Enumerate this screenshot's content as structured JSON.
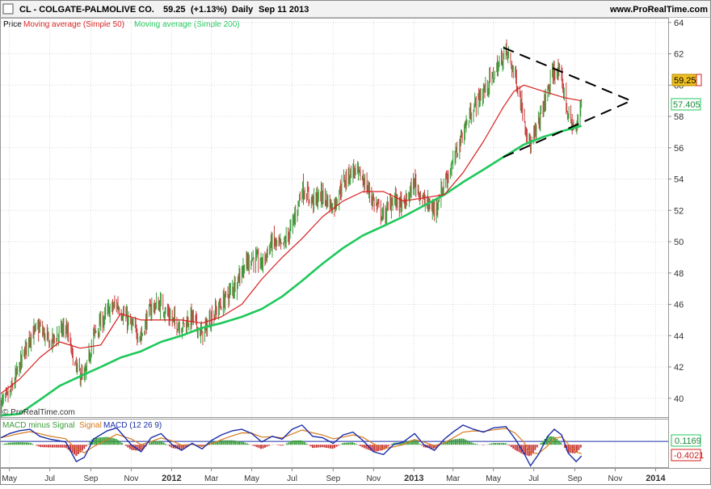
{
  "header": {
    "ticker": "CL - COLGATE-PALMOLIVE CO.",
    "price": "59.25",
    "change": "(+1.13%)",
    "period": "Daily",
    "date": "Sep 11 2013",
    "site": "www.ProRealTime.com"
  },
  "legend": {
    "price": "Price",
    "ma50": "Moving average (Simple 50)",
    "ma200": "Moving average (Simple 200)"
  },
  "watermark": "© ProRealTime.com",
  "macd_legend": {
    "histogram": "MACD minus Signal",
    "signal": "Signal",
    "macd": "MACD (12 26 9)"
  },
  "colors": {
    "up": "#3a9d3a",
    "down": "#c83c3c",
    "ma50": "#d81e1e",
    "ma200": "#1ec85a",
    "macd": "#1a2ea8",
    "signal": "#d87a1e",
    "price_tag": "#f0c020",
    "ma200_tag": "#1ec85a",
    "macd_tag": "#1ec85a",
    "signal_tag": "#d81e1e"
  },
  "chart_data": {
    "type": "candlestick",
    "x_start": "2011-04-18",
    "x_end": "2014-01-20",
    "y_range": [
      38.8,
      64.3
    ],
    "y_ticks": [
      "40",
      "42",
      "44",
      "46",
      "48",
      "50",
      "52",
      "54",
      "56",
      "58",
      "60",
      "62",
      "64"
    ],
    "x_ticks": [
      {
        "date": "2011-05-01",
        "label": "May"
      },
      {
        "date": "2011-07-01",
        "label": "Jul"
      },
      {
        "date": "2011-09-01",
        "label": "Sep"
      },
      {
        "date": "2011-11-01",
        "label": "Nov"
      },
      {
        "date": "2012-01-01",
        "label": "2012"
      },
      {
        "date": "2012-03-01",
        "label": "Mar"
      },
      {
        "date": "2012-05-01",
        "label": "May"
      },
      {
        "date": "2012-07-01",
        "label": "Jul"
      },
      {
        "date": "2012-09-01",
        "label": "Sep"
      },
      {
        "date": "2012-11-01",
        "label": "Nov"
      },
      {
        "date": "2013-01-01",
        "label": "2013"
      },
      {
        "date": "2013-03-01",
        "label": "Mar"
      },
      {
        "date": "2013-05-01",
        "label": "May"
      },
      {
        "date": "2013-07-01",
        "label": "Jul"
      },
      {
        "date": "2013-09-01",
        "label": "Sep"
      },
      {
        "date": "2013-11-01",
        "label": "Nov"
      },
      {
        "date": "2014-01-01",
        "label": "2014"
      }
    ],
    "close_path": [
      [
        "2011-04-18",
        39.6
      ],
      [
        "2011-05-01",
        40.2
      ],
      [
        "2011-05-16",
        42.0
      ],
      [
        "2011-06-01",
        44.0
      ],
      [
        "2011-06-16",
        44.5
      ],
      [
        "2011-07-01",
        43.5
      ],
      [
        "2011-07-25",
        44.6
      ],
      [
        "2011-08-08",
        42.0
      ],
      [
        "2011-08-22",
        41.2
      ],
      [
        "2011-09-05",
        44.0
      ],
      [
        "2011-09-26",
        45.5
      ],
      [
        "2011-10-10",
        46.0
      ],
      [
        "2011-11-01",
        44.6
      ],
      [
        "2011-11-16",
        44.0
      ],
      [
        "2011-12-01",
        45.8
      ],
      [
        "2011-12-16",
        46.0
      ],
      [
        "2012-01-02",
        45.0
      ],
      [
        "2012-01-16",
        44.6
      ],
      [
        "2012-02-01",
        45.2
      ],
      [
        "2012-02-16",
        44.0
      ],
      [
        "2012-03-01",
        45.2
      ],
      [
        "2012-03-16",
        46.0
      ],
      [
        "2012-04-02",
        47.0
      ],
      [
        "2012-04-16",
        48.2
      ],
      [
        "2012-05-01",
        49.0
      ],
      [
        "2012-05-16",
        48.6
      ],
      [
        "2012-06-01",
        50.0
      ],
      [
        "2012-06-16",
        49.6
      ],
      [
        "2012-07-01",
        51.0
      ],
      [
        "2012-07-16",
        53.4
      ],
      [
        "2012-08-01",
        52.6
      ],
      [
        "2012-08-16",
        53.0
      ],
      [
        "2012-09-01",
        52.2
      ],
      [
        "2012-09-16",
        53.8
      ],
      [
        "2012-10-01",
        54.6
      ],
      [
        "2012-10-16",
        54.0
      ],
      [
        "2012-11-01",
        52.6
      ],
      [
        "2012-11-16",
        51.6
      ],
      [
        "2012-12-01",
        52.8
      ],
      [
        "2012-12-16",
        52.2
      ],
      [
        "2013-01-02",
        53.8
      ],
      [
        "2013-01-16",
        52.6
      ],
      [
        "2013-02-01",
        52.0
      ],
      [
        "2013-02-16",
        53.8
      ],
      [
        "2013-03-01",
        55.0
      ],
      [
        "2013-03-16",
        57.0
      ],
      [
        "2013-04-01",
        58.6
      ],
      [
        "2013-04-16",
        59.6
      ],
      [
        "2013-05-01",
        60.6
      ],
      [
        "2013-05-20",
        62.2
      ],
      [
        "2013-06-03",
        60.6
      ],
      [
        "2013-06-16",
        58.0
      ],
      [
        "2013-06-26",
        56.0
      ],
      [
        "2013-07-08",
        57.6
      ],
      [
        "2013-07-22",
        59.6
      ],
      [
        "2013-08-01",
        61.0
      ],
      [
        "2013-08-12",
        60.4
      ],
      [
        "2013-08-22",
        58.0
      ],
      [
        "2013-09-03",
        57.0
      ],
      [
        "2013-09-11",
        59.25
      ]
    ],
    "ma50": [
      [
        "2011-04-18",
        40.3
      ],
      [
        "2011-05-16",
        41.2
      ],
      [
        "2011-06-16",
        42.6
      ],
      [
        "2011-07-16",
        43.6
      ],
      [
        "2011-08-16",
        43.2
      ],
      [
        "2011-09-16",
        43.4
      ],
      [
        "2011-10-01",
        44.4
      ],
      [
        "2011-10-16",
        45.4
      ],
      [
        "2011-11-16",
        45.0
      ],
      [
        "2011-12-16",
        45.0
      ],
      [
        "2012-01-16",
        45.0
      ],
      [
        "2012-02-16",
        44.8
      ],
      [
        "2012-03-16",
        45.2
      ],
      [
        "2012-04-16",
        46.0
      ],
      [
        "2012-05-16",
        47.6
      ],
      [
        "2012-06-16",
        49.0
      ],
      [
        "2012-07-16",
        50.2
      ],
      [
        "2012-08-16",
        51.6
      ],
      [
        "2012-09-16",
        52.6
      ],
      [
        "2012-10-16",
        53.2
      ],
      [
        "2012-11-16",
        53.2
      ],
      [
        "2012-12-16",
        52.6
      ],
      [
        "2013-01-16",
        52.8
      ],
      [
        "2013-02-16",
        53.0
      ],
      [
        "2013-03-16",
        54.4
      ],
      [
        "2013-04-16",
        56.4
      ],
      [
        "2013-05-16",
        58.6
      ],
      [
        "2013-06-01",
        59.6
      ],
      [
        "2013-06-16",
        60.0
      ],
      [
        "2013-07-16",
        59.6
      ],
      [
        "2013-08-16",
        59.2
      ],
      [
        "2013-09-11",
        59.0
      ]
    ],
    "ma200": [
      [
        "2011-04-18",
        38.9
      ],
      [
        "2011-05-16",
        39.0
      ],
      [
        "2011-06-16",
        39.9
      ],
      [
        "2011-07-16",
        40.8
      ],
      [
        "2011-08-16",
        41.4
      ],
      [
        "2011-09-16",
        42.0
      ],
      [
        "2011-10-16",
        42.6
      ],
      [
        "2011-11-16",
        43.0
      ],
      [
        "2011-12-16",
        43.6
      ],
      [
        "2012-01-16",
        44.0
      ],
      [
        "2012-02-16",
        44.5
      ],
      [
        "2012-03-16",
        44.8
      ],
      [
        "2012-04-16",
        45.2
      ],
      [
        "2012-05-16",
        45.7
      ],
      [
        "2012-06-16",
        46.5
      ],
      [
        "2012-07-16",
        47.5
      ],
      [
        "2012-08-16",
        48.6
      ],
      [
        "2012-09-16",
        49.6
      ],
      [
        "2012-10-16",
        50.4
      ],
      [
        "2012-11-16",
        51.0
      ],
      [
        "2012-12-16",
        51.6
      ],
      [
        "2013-01-16",
        52.3
      ],
      [
        "2013-02-16",
        53.0
      ],
      [
        "2013-03-16",
        53.8
      ],
      [
        "2013-04-16",
        54.6
      ],
      [
        "2013-05-16",
        55.4
      ],
      [
        "2013-06-16",
        56.2
      ],
      [
        "2013-07-16",
        56.7
      ],
      [
        "2013-08-16",
        57.1
      ],
      [
        "2013-09-11",
        57.4
      ]
    ],
    "trendlines": [
      {
        "from": [
          "2013-05-16",
          62.4
        ],
        "to": [
          "2013-11-25",
          59.0
        ]
      },
      {
        "from": [
          "2013-05-16",
          55.4
        ],
        "to": [
          "2013-11-25",
          59.0
        ]
      }
    ],
    "price_labels": {
      "last": "59.25",
      "ma50": "59.25",
      "ma200": "57.405"
    },
    "macd": {
      "y_range": [
        -0.8,
        0.9
      ],
      "zero_line": 0.1169,
      "labels": {
        "macd": "0.1169",
        "signal": "-0.4021"
      },
      "macd_path": [
        [
          "2011-04-18",
          0.25
        ],
        [
          "2011-05-01",
          0.4
        ],
        [
          "2011-05-16",
          0.5
        ],
        [
          "2011-06-01",
          0.55
        ],
        [
          "2011-06-16",
          0.3
        ],
        [
          "2011-07-01",
          0.2
        ],
        [
          "2011-07-25",
          0.1
        ],
        [
          "2011-08-10",
          -0.6
        ],
        [
          "2011-08-22",
          -0.45
        ],
        [
          "2011-09-05",
          0.2
        ],
        [
          "2011-09-26",
          0.5
        ],
        [
          "2011-10-10",
          0.6
        ],
        [
          "2011-11-01",
          0.0
        ],
        [
          "2011-11-16",
          -0.25
        ],
        [
          "2011-12-01",
          0.25
        ],
        [
          "2011-12-16",
          0.4
        ],
        [
          "2012-01-02",
          0.0
        ],
        [
          "2012-01-16",
          -0.2
        ],
        [
          "2012-02-01",
          0.05
        ],
        [
          "2012-02-16",
          -0.15
        ],
        [
          "2012-03-01",
          0.15
        ],
        [
          "2012-03-16",
          0.35
        ],
        [
          "2012-04-02",
          0.5
        ],
        [
          "2012-04-16",
          0.55
        ],
        [
          "2012-05-01",
          0.4
        ],
        [
          "2012-05-16",
          0.1
        ],
        [
          "2012-06-01",
          0.3
        ],
        [
          "2012-06-16",
          0.2
        ],
        [
          "2012-07-01",
          0.55
        ],
        [
          "2012-07-16",
          0.7
        ],
        [
          "2012-08-01",
          0.3
        ],
        [
          "2012-08-16",
          0.25
        ],
        [
          "2012-09-01",
          0.05
        ],
        [
          "2012-09-16",
          0.35
        ],
        [
          "2012-10-01",
          0.45
        ],
        [
          "2012-10-16",
          0.15
        ],
        [
          "2012-11-01",
          -0.25
        ],
        [
          "2012-11-16",
          -0.35
        ],
        [
          "2012-12-01",
          0.0
        ],
        [
          "2012-12-16",
          0.1
        ],
        [
          "2013-01-02",
          0.4
        ],
        [
          "2013-01-16",
          0.0
        ],
        [
          "2013-02-01",
          -0.2
        ],
        [
          "2013-02-16",
          0.2
        ],
        [
          "2013-03-01",
          0.45
        ],
        [
          "2013-03-16",
          0.7
        ],
        [
          "2013-04-01",
          0.55
        ],
        [
          "2013-04-16",
          0.45
        ],
        [
          "2013-05-01",
          0.6
        ],
        [
          "2013-05-20",
          0.65
        ],
        [
          "2013-06-03",
          0.2
        ],
        [
          "2013-06-16",
          -0.3
        ],
        [
          "2013-06-26",
          -0.75
        ],
        [
          "2013-07-08",
          -0.35
        ],
        [
          "2013-07-22",
          0.3
        ],
        [
          "2013-08-01",
          0.55
        ],
        [
          "2013-08-12",
          0.35
        ],
        [
          "2013-08-22",
          -0.3
        ],
        [
          "2013-09-03",
          -0.6
        ],
        [
          "2013-09-11",
          -0.4
        ]
      ]
    }
  }
}
